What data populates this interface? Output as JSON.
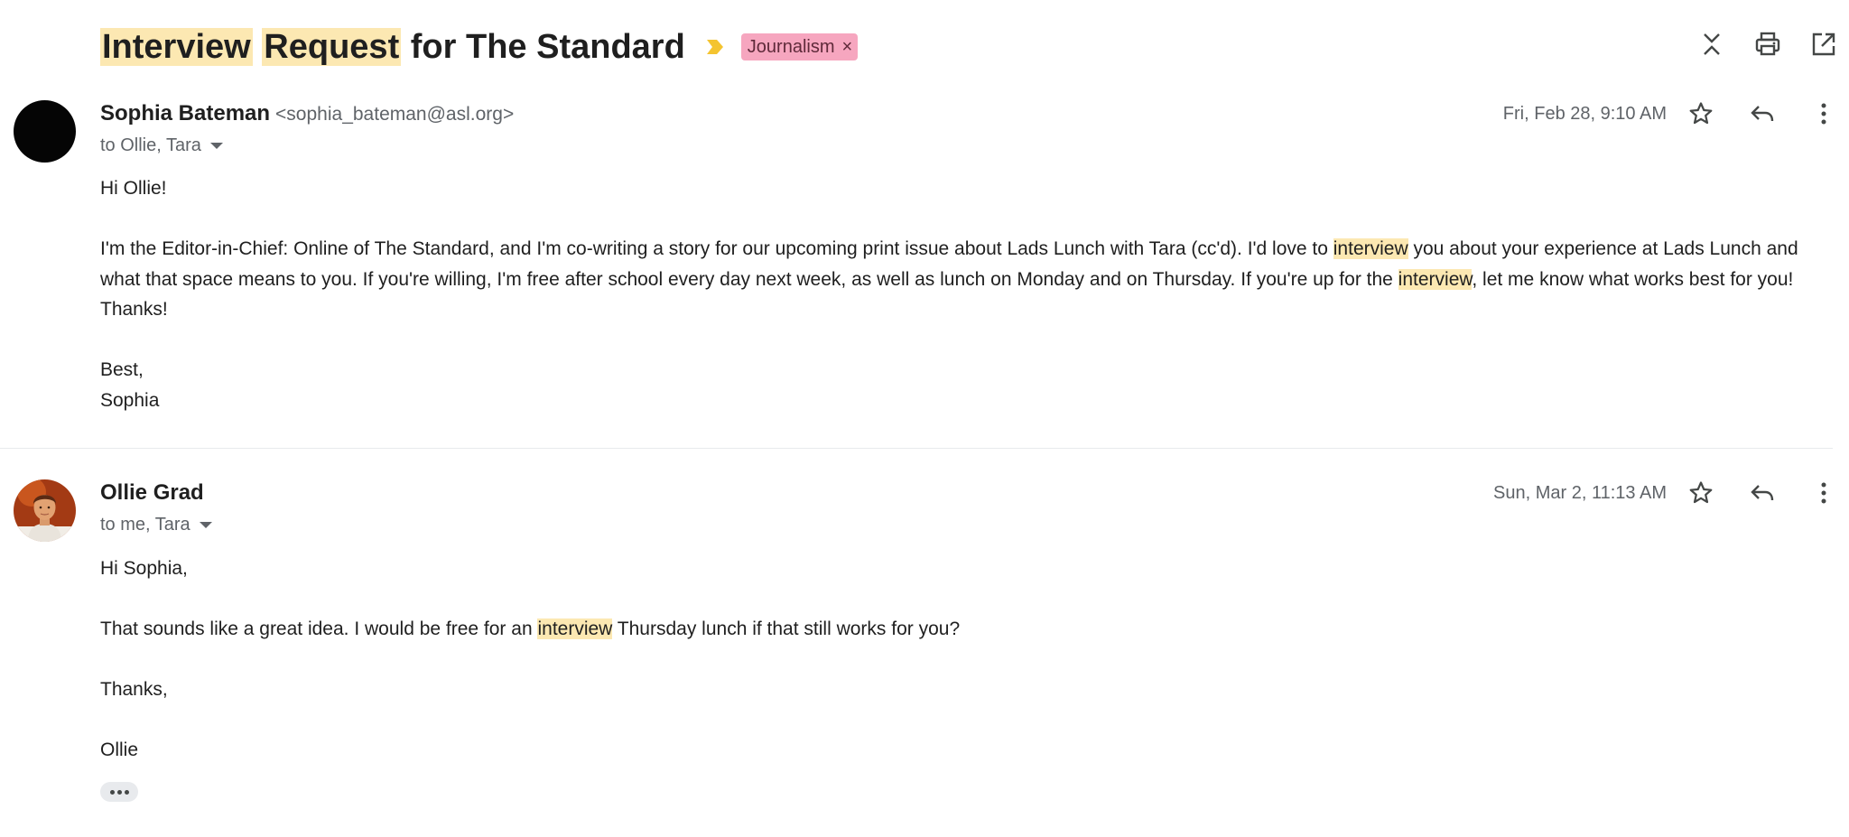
{
  "subject": {
    "parts": [
      "Interview",
      " ",
      "Request",
      " for The Standard"
    ],
    "label": "Journalism",
    "label_remove": "×",
    "importance_color": "#f4c430",
    "label_color": "#f6a6bf"
  },
  "toolbar": {
    "icons": [
      "collapse-all-icon",
      "print-icon",
      "open-in-new-window-icon"
    ]
  },
  "messages": [
    {
      "sender_name": "Sophia Bateman",
      "sender_email": "<sophia_bateman@asl.org>",
      "recipients": "to Ollie, Tara",
      "date": "Fri, Feb 28, 9:10 AM",
      "greeting": "Hi Ollie!",
      "para1_a": "I'm the Editor-in-Chief: Online of The Standard, and I'm co-writing a story for our upcoming print issue about Lads Lunch with Tara (cc'd). I'd love to ",
      "para1_hl1": "interview",
      "para1_b": " you about your experience at Lads Lunch and what that space means to you. If you're willing, I'm free after school every day next week, as well as lunch on Monday and on Thursday. If you're up for the ",
      "para1_hl2": "interview",
      "para1_c": ", let me know what works best for you! Thanks!",
      "signoff": "Best,",
      "signature": "Sophia",
      "avatar_color": "#050505"
    },
    {
      "sender_name": "Ollie Grad",
      "recipients": "to me, Tara",
      "date": "Sun, Mar 2, 11:13 AM",
      "greeting": "Hi Sophia,",
      "para1_a": "That sounds like a great idea. I would be free for an ",
      "para1_hl1": "interview",
      "para1_b": " Thursday lunch if that still works for you?",
      "signoff": "Thanks,",
      "signature": "Ollie"
    }
  ],
  "message_icons": [
    "star-icon",
    "reply-icon",
    "more-vert-icon"
  ],
  "highlight_color": "#fce8b2"
}
